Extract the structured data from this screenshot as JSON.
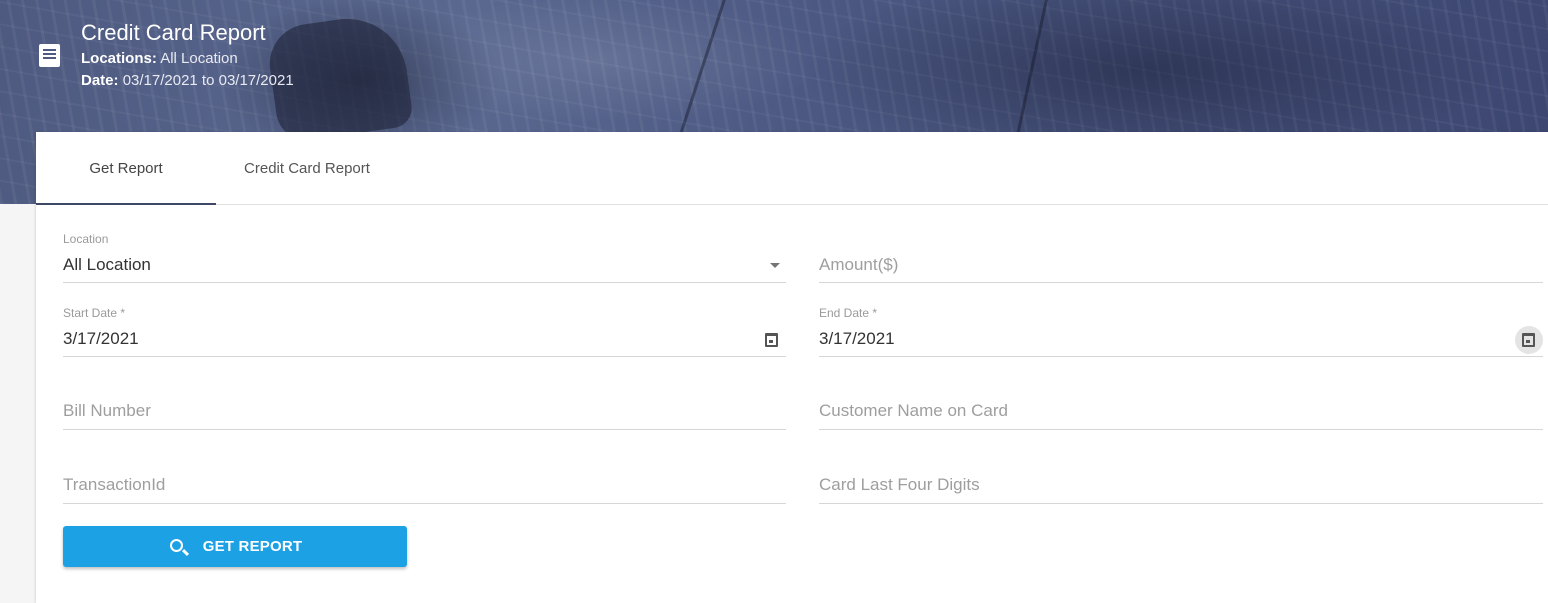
{
  "header": {
    "title": "Credit Card Report",
    "locations_label": "Locations:",
    "locations_value": "All Location",
    "date_label": "Date:",
    "date_value": "03/17/2021 to 03/17/2021",
    "icon": "receipt-icon"
  },
  "tabs": [
    {
      "label": "Get Report",
      "active": true
    },
    {
      "label": "Credit Card Report",
      "active": false
    }
  ],
  "form": {
    "location": {
      "label": "Location",
      "value": "All Location"
    },
    "amount": {
      "placeholder": "Amount($)"
    },
    "start_date": {
      "label": "Start Date *",
      "value": "3/17/2021"
    },
    "end_date": {
      "label": "End Date *",
      "value": "3/17/2021"
    },
    "bill_number": {
      "placeholder": "Bill Number"
    },
    "customer_name": {
      "placeholder": "Customer Name on Card"
    },
    "transaction_id": {
      "placeholder": "TransactionId"
    },
    "card_last_four": {
      "placeholder": "Card Last Four Digits"
    }
  },
  "button": {
    "label": "GET REPORT",
    "icon": "search-refresh-icon"
  },
  "colors": {
    "banner": "#4e5a80",
    "button": "#1da1e5",
    "tab_indicator": "#3f4766"
  }
}
